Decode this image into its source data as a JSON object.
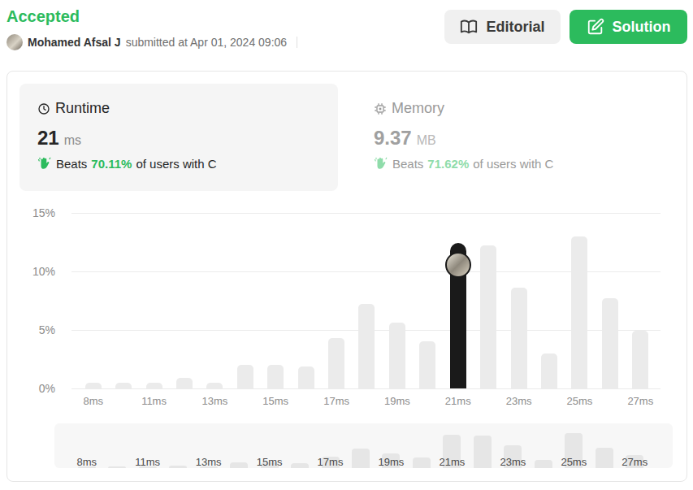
{
  "status": "Accepted",
  "submission": {
    "user": "Mohamed Afsal J",
    "submitted_text": "submitted at Apr 01, 2024 09:06"
  },
  "buttons": [
    {
      "label": "Editorial",
      "kind": "secondary"
    },
    {
      "label": "Solution",
      "kind": "primary"
    }
  ],
  "metrics": [
    {
      "label": "Runtime",
      "kind": "runtime",
      "value": "21",
      "unit": "ms",
      "beats_label": "Beats",
      "beats_value": "70.11%",
      "beats_suffix": "of users with C",
      "selected": true
    },
    {
      "label": "Memory",
      "kind": "memory",
      "value": "9.37",
      "unit": "MB",
      "beats_label": "Beats",
      "beats_value": "71.62%",
      "beats_suffix": "of users with C",
      "selected": false
    }
  ],
  "chart": {
    "y_ticks": [
      "15%",
      "10%",
      "5%",
      "0%"
    ],
    "x_ticks": [
      "8ms",
      "11ms",
      "13ms",
      "15ms",
      "17ms",
      "19ms",
      "21ms",
      "23ms",
      "25ms",
      "27ms"
    ],
    "bars": [
      {
        "value": 0.5,
        "selected": false
      },
      {
        "value": 0.5,
        "selected": false
      },
      {
        "value": 0.5,
        "selected": false
      },
      {
        "value": 0.9,
        "selected": false
      },
      {
        "value": 0.5,
        "selected": false
      },
      {
        "value": 2.0,
        "selected": false
      },
      {
        "value": 2.0,
        "selected": false
      },
      {
        "value": 1.9,
        "selected": false
      },
      {
        "value": 4.3,
        "selected": false
      },
      {
        "value": 7.2,
        "selected": false
      },
      {
        "value": 5.6,
        "selected": false
      },
      {
        "value": 4.0,
        "selected": false
      },
      {
        "value": 12.4,
        "selected": true
      },
      {
        "value": 12.2,
        "selected": false
      },
      {
        "value": 8.6,
        "selected": false
      },
      {
        "value": 3.0,
        "selected": false
      },
      {
        "value": 13.0,
        "selected": false
      },
      {
        "value": 7.7,
        "selected": false
      },
      {
        "value": 4.9,
        "selected": false
      }
    ]
  }
}
